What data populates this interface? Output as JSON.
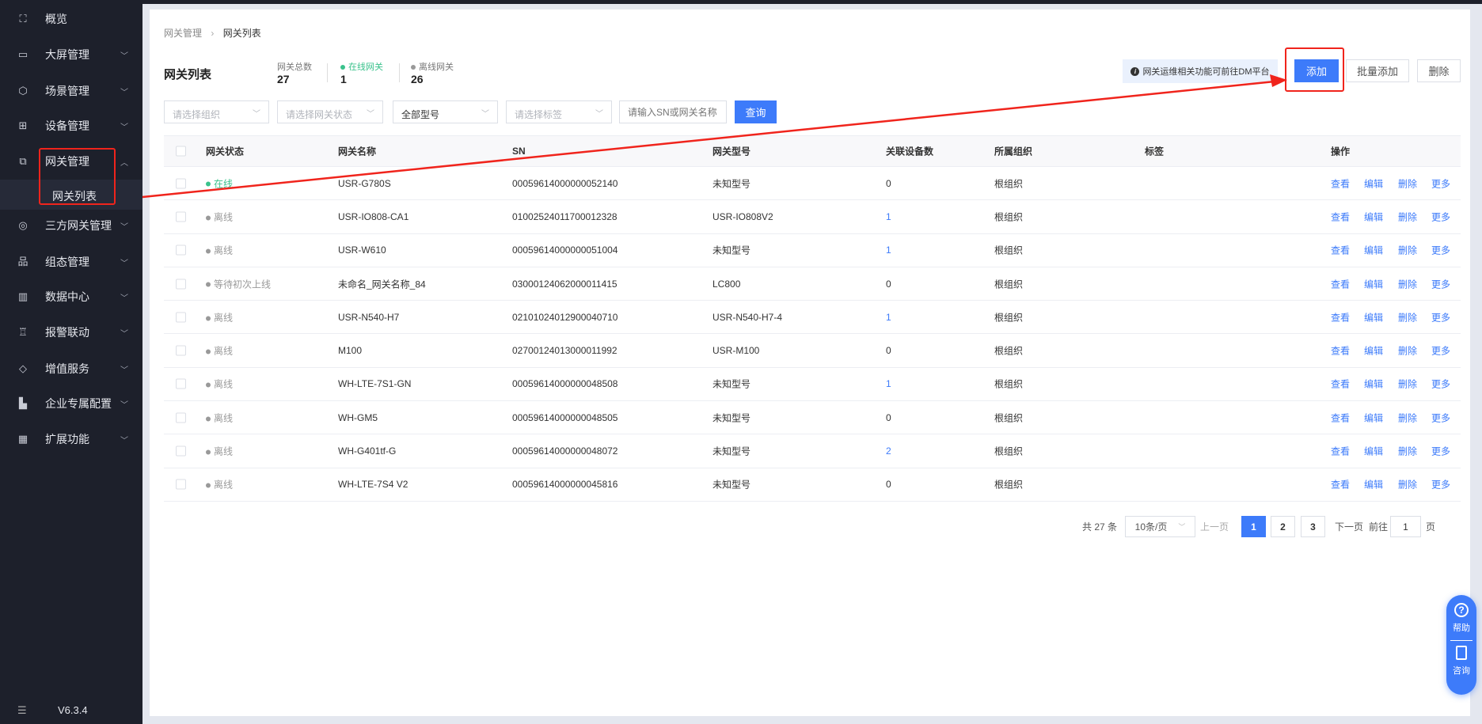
{
  "sidebar": {
    "items": [
      {
        "label": "概览",
        "icon": "overview-icon",
        "chev": ""
      },
      {
        "label": "大屏管理",
        "icon": "screen-icon",
        "chev": "﹀"
      },
      {
        "label": "场景管理",
        "icon": "scene-icon",
        "chev": "﹀"
      },
      {
        "label": "设备管理",
        "icon": "device-icon",
        "chev": "﹀"
      },
      {
        "label": "网关管理",
        "icon": "gateway-icon",
        "chev": "︿"
      },
      {
        "label": "三方网关管理",
        "icon": "third-party-icon",
        "chev": "﹀"
      },
      {
        "label": "组态管理",
        "icon": "config-icon",
        "chev": "﹀"
      },
      {
        "label": "数据中心",
        "icon": "chart-icon",
        "chev": "﹀"
      },
      {
        "label": "报警联动",
        "icon": "alarm-icon",
        "chev": "﹀"
      },
      {
        "label": "增值服务",
        "icon": "diamond-icon",
        "chev": "﹀"
      },
      {
        "label": "企业专属配置",
        "icon": "building-icon",
        "chev": "﹀"
      },
      {
        "label": "扩展功能",
        "icon": "apps-icon",
        "chev": "﹀"
      }
    ],
    "sub_item": "网关列表",
    "version": "V6.3.4"
  },
  "breadcrumb": [
    "网关管理",
    "网关列表"
  ],
  "page_title": "网关列表",
  "stats": {
    "total_label": "网关总数",
    "total": "27",
    "online_label": "在线网关",
    "online": "1",
    "offline_label": "离线网关",
    "offline": "26"
  },
  "notice": "网关运维相关功能可前往DM平台",
  "buttons": {
    "add": "添加",
    "batch_add": "批量添加",
    "delete": "删除",
    "query": "查询"
  },
  "filters": {
    "org": "请选择组织",
    "status": "请选择网关状态",
    "model": "全部型号",
    "tag": "请选择标签",
    "search_placeholder": "请输入SN或网关名称"
  },
  "table": {
    "headers": [
      "网关状态",
      "网关名称",
      "SN",
      "网关型号",
      "关联设备数",
      "所属组织",
      "标签",
      "操作"
    ],
    "actions": [
      "查看",
      "编辑",
      "删除",
      "更多"
    ],
    "rows": [
      [
        "在线",
        "USR-G780S",
        "00059614000000052140",
        "未知型号",
        "0",
        "根组织"
      ],
      [
        "离线",
        "USR-IO808-CA1",
        "01002524011700012328",
        "USR-IO808V2",
        "1",
        "根组织"
      ],
      [
        "离线",
        "USR-W610",
        "00059614000000051004",
        "未知型号",
        "1",
        "根组织"
      ],
      [
        "等待初次上线",
        "未命名_网关名称_84",
        "03000124062000011415",
        "LC800",
        "0",
        "根组织"
      ],
      [
        "离线",
        "USR-N540-H7",
        "02101024012900040710",
        "USR-N540-H7-4",
        "1",
        "根组织"
      ],
      [
        "离线",
        "M100",
        "02700124013000011992",
        "USR-M100",
        "0",
        "根组织"
      ],
      [
        "离线",
        "WH-LTE-7S1-GN",
        "00059614000000048508",
        "未知型号",
        "1",
        "根组织"
      ],
      [
        "离线",
        "WH-GM5",
        "00059614000000048505",
        "未知型号",
        "0",
        "根组织"
      ],
      [
        "离线",
        "WH-G401tf-G",
        "00059614000000048072",
        "未知型号",
        "2",
        "根组织"
      ],
      [
        "离线",
        "WH-LTE-7S4 V2",
        "00059614000000045816",
        "未知型号",
        "0",
        "根组织"
      ]
    ]
  },
  "pagination": {
    "total": "共 27 条",
    "page_size": "10条/页",
    "prev": "上一页",
    "pages": [
      "1",
      "2",
      "3"
    ],
    "next": "下一页",
    "goto": "前往",
    "goto_value": "1",
    "page_unit": "页"
  },
  "help": {
    "help": "帮助",
    "consult": "咨询"
  },
  "colors": {
    "primary": "#3d7bfa",
    "online": "#3ac28c",
    "offline": "#999999",
    "annotation": "#f0241c"
  }
}
